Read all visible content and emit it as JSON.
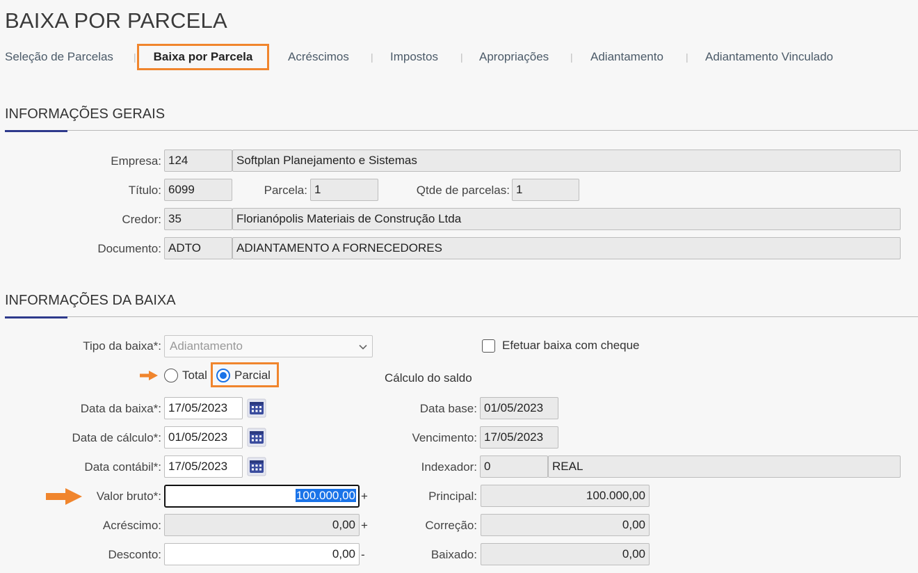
{
  "page": {
    "title": "BAIXA POR PARCELA"
  },
  "tabs": [
    {
      "label": "Seleção de Parcelas"
    },
    {
      "label": "Baixa por Parcela"
    },
    {
      "label": "Acréscimos"
    },
    {
      "label": "Impostos"
    },
    {
      "label": "Apropriações"
    },
    {
      "label": "Adiantamento"
    },
    {
      "label": "Adiantamento Vinculado"
    }
  ],
  "tab_separator": "|",
  "geral": {
    "title": "INFORMAÇÕES GERAIS",
    "empresa": {
      "label": "Empresa:",
      "code": "124",
      "name": "Softplan Planejamento e Sistemas"
    },
    "titulo": {
      "label": "Título:",
      "value": "6099"
    },
    "parcela": {
      "label": "Parcela:",
      "value": "1"
    },
    "qtde": {
      "label": "Qtde de parcelas:",
      "value": "1"
    },
    "credor": {
      "label": "Credor:",
      "code": "35",
      "name": "Florianópolis Materiais de Construção Ltda"
    },
    "documento": {
      "label": "Documento:",
      "code": "ADTO",
      "name": "ADIANTAMENTO A FORNECEDORES"
    }
  },
  "baixa": {
    "title": "INFORMAÇÕES DA BAIXA",
    "tipo": {
      "label": "Tipo da baixa*:",
      "value": "Adiantamento"
    },
    "cheque": {
      "label": "Efetuar baixa com cheque",
      "checked": false
    },
    "radio_total": "Total",
    "radio_parcial": "Parcial",
    "selected_mode": "Parcial",
    "data_baixa": {
      "label": "Data da baixa*:",
      "value": "17/05/2023"
    },
    "data_calculo": {
      "label": "Data de cálculo*:",
      "value": "01/05/2023"
    },
    "data_contabil": {
      "label": "Data contábil*:",
      "value": "17/05/2023"
    },
    "valor_bruto": {
      "label": "Valor bruto*:",
      "value": "100.000,00",
      "sign": "+"
    },
    "acrescimo": {
      "label": "Acréscimo:",
      "value": "0,00",
      "sign": "+"
    },
    "desconto": {
      "label": "Desconto:",
      "value": "0,00",
      "sign": "-"
    }
  },
  "saldo": {
    "title": "Cálculo do saldo",
    "data_base": {
      "label": "Data base:",
      "value": "01/05/2023"
    },
    "vencimento": {
      "label": "Vencimento:",
      "value": "17/05/2023"
    },
    "indexador": {
      "label": "Indexador:",
      "code": "0",
      "name": "REAL"
    },
    "principal": {
      "label": "Principal:",
      "value": "100.000,00"
    },
    "correcao": {
      "label": "Correção:",
      "value": "0,00"
    },
    "baixado": {
      "label": "Baixado:",
      "value": "0,00"
    }
  },
  "colors": {
    "accent_orange": "#f0852d",
    "section_accent": "#2e3a8c",
    "radio_blue": "#1a73e8",
    "calendar_icon": "#3a4c9e"
  },
  "icons": {
    "calendar": "calendar-icon",
    "chevron": "chevron-down-icon",
    "arrow": "arrow-right-icon"
  }
}
